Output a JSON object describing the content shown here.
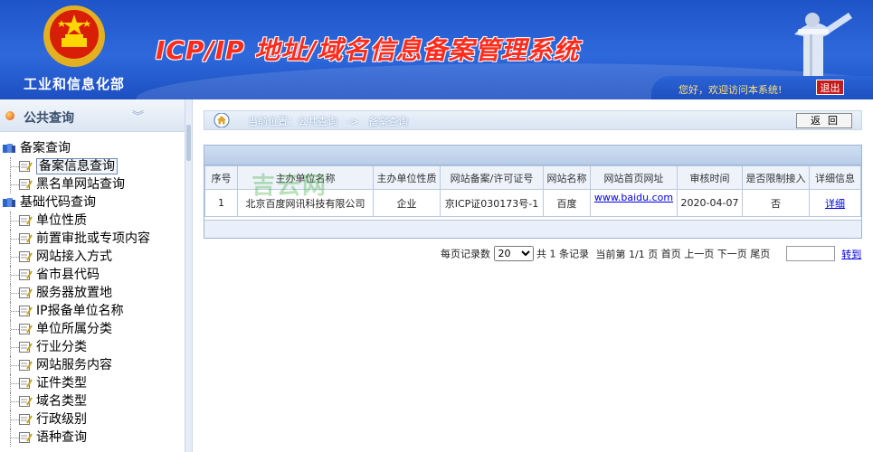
{
  "header": {
    "org_name": "工业和信息化部",
    "system_title": "ICP/IP 地址/域名信息备案管理系统",
    "welcome_text": "您好，欢迎访问本系统!",
    "logout_label": "退出",
    "emblem_icon": "national-emblem-icon",
    "pillar_icon": "huabiao-pillar-icon"
  },
  "sidebar": {
    "section_title": "公共查询",
    "groups": [
      {
        "label": "备案查询",
        "items": [
          {
            "label": "备案信息查询",
            "active": true
          },
          {
            "label": "黑名单网站查询"
          }
        ]
      },
      {
        "label": "基础代码查询",
        "items": [
          {
            "label": "单位性质"
          },
          {
            "label": "前置审批或专项内容"
          },
          {
            "label": "网站接入方式"
          },
          {
            "label": "省市县代码"
          },
          {
            "label": "服务器放置地"
          },
          {
            "label": "IP报备单位名称"
          },
          {
            "label": "单位所属分类"
          },
          {
            "label": "行业分类"
          },
          {
            "label": "网站服务内容"
          },
          {
            "label": "证件类型"
          },
          {
            "label": "域名类型"
          },
          {
            "label": "行政级别"
          },
          {
            "label": "语种查询"
          }
        ]
      }
    ]
  },
  "breadcrumb": {
    "prefix": "当前位置：",
    "path1": "公共查询",
    "arrow": "->",
    "path2": "备案查询",
    "back_label": "返回"
  },
  "table": {
    "columns": [
      "序号",
      "主办单位名称",
      "主办单位性质",
      "网站备案/许可证号",
      "网站名称",
      "网站首页网址",
      "审核时间",
      "是否限制接入",
      "详细信息"
    ],
    "rows": [
      {
        "index": "1",
        "org": "北京百度网讯科技有限公司",
        "nature": "企业",
        "license": "京ICP证030173号-1",
        "site_name": "百度",
        "url": "www.baidu.com",
        "audit_date": "2020-04-07",
        "restricted": "否",
        "detail": "详细"
      }
    ],
    "watermark": "吉云网"
  },
  "pager": {
    "per_page_label": "每页记录数",
    "per_page_value": "20",
    "total_text": "共 1 条记录",
    "page_text": "当前第 1/1 页",
    "first": "首页",
    "prev": "上一页",
    "next": "下一页",
    "last": "尾页",
    "goto_label": "转到"
  },
  "colors": {
    "header_blue": "#2e69dc",
    "title_red": "#ff2b1c",
    "welcome_yellow": "#ffe27a",
    "logout_red": "#c41b1b",
    "link_blue": "#0000ee"
  }
}
